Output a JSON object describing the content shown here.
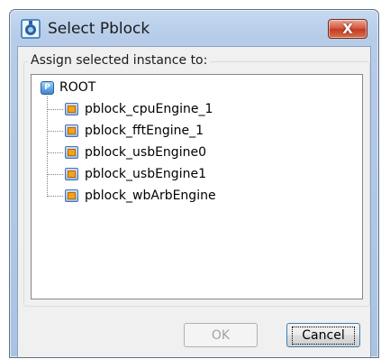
{
  "dialog": {
    "title": "Select Pblock",
    "close_label": "X"
  },
  "group": {
    "label": "Assign selected instance to:"
  },
  "tree": {
    "root": {
      "label": "ROOT",
      "icon": "p-icon"
    },
    "items": [
      {
        "label": "pblock_cpuEngine_1",
        "icon": "pblock-icon"
      },
      {
        "label": "pblock_fftEngine_1",
        "icon": "pblock-icon"
      },
      {
        "label": "pblock_usbEngine0",
        "icon": "pblock-icon"
      },
      {
        "label": "pblock_usbEngine1",
        "icon": "pblock-icon"
      },
      {
        "label": "pblock_wbArbEngine",
        "icon": "pblock-icon"
      }
    ]
  },
  "buttons": {
    "ok_label": "OK",
    "cancel_label": "Cancel"
  },
  "colors": {
    "titlebar": "#b6cce8",
    "close_button": "#c13b24",
    "dialog_body": "#f0f0f0",
    "pblock_icon_inner": "#f2a31b"
  }
}
